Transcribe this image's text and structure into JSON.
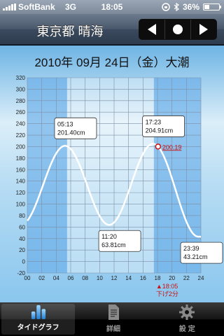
{
  "status_bar": {
    "carrier": "SoftBank",
    "network": "3G",
    "time": "18:05",
    "battery": "36%",
    "battery_level": 0.36
  },
  "nav": {
    "title": "東京都 晴海",
    "prev_icon": "triangle-left-icon",
    "today_icon": "circle-icon",
    "next_icon": "triangle-right-icon"
  },
  "date_title": "2010年 09月 24日（金）大潮",
  "tabs": [
    {
      "label": "タイドグラフ",
      "icon": "tide-graph-icon",
      "selected": true
    },
    {
      "label": "詳細",
      "icon": "document-icon",
      "selected": false
    },
    {
      "label": "設 定",
      "icon": "gear-icon",
      "selected": false
    }
  ],
  "colors": {
    "accent_red": "#cc1111",
    "curve": "#ffffff",
    "night_shade": "#2a8be0"
  },
  "chart_data": {
    "type": "line",
    "title": "",
    "xlabel": "",
    "ylabel": "",
    "xlim": [
      0,
      24
    ],
    "ylim": [
      -20,
      320
    ],
    "x_ticks": [
      "00",
      "02",
      "04",
      "06",
      "08",
      "10",
      "12",
      "14",
      "16",
      "18",
      "20",
      "22",
      "24"
    ],
    "y_ticks": [
      "-20",
      "0",
      "20",
      "40",
      "60",
      "80",
      "100",
      "120",
      "140",
      "160",
      "180",
      "200",
      "220",
      "240",
      "260",
      "280",
      "300",
      "320"
    ],
    "grid": true,
    "night_ranges": [
      [
        0,
        5.5
      ],
      [
        17.5,
        24
      ]
    ],
    "tide_events": [
      {
        "hour": 5.22,
        "value": 201.4,
        "time": "05:13",
        "height": "201.40cm",
        "type": "high"
      },
      {
        "hour": 11.33,
        "value": 63.81,
        "time": "11:20",
        "height": "63.81cm",
        "type": "low"
      },
      {
        "hour": 17.38,
        "value": 204.91,
        "time": "17:23",
        "height": "204.91cm",
        "type": "high"
      },
      {
        "hour": 23.65,
        "value": 43.21,
        "time": "23:39",
        "height": "43.21cm",
        "type": "low"
      }
    ],
    "start_value": 60,
    "current": {
      "hour": 18.08,
      "value": 200.19,
      "value_label": "200.19",
      "time_label": "▲18:05",
      "trend_label": "下げ2分"
    }
  }
}
